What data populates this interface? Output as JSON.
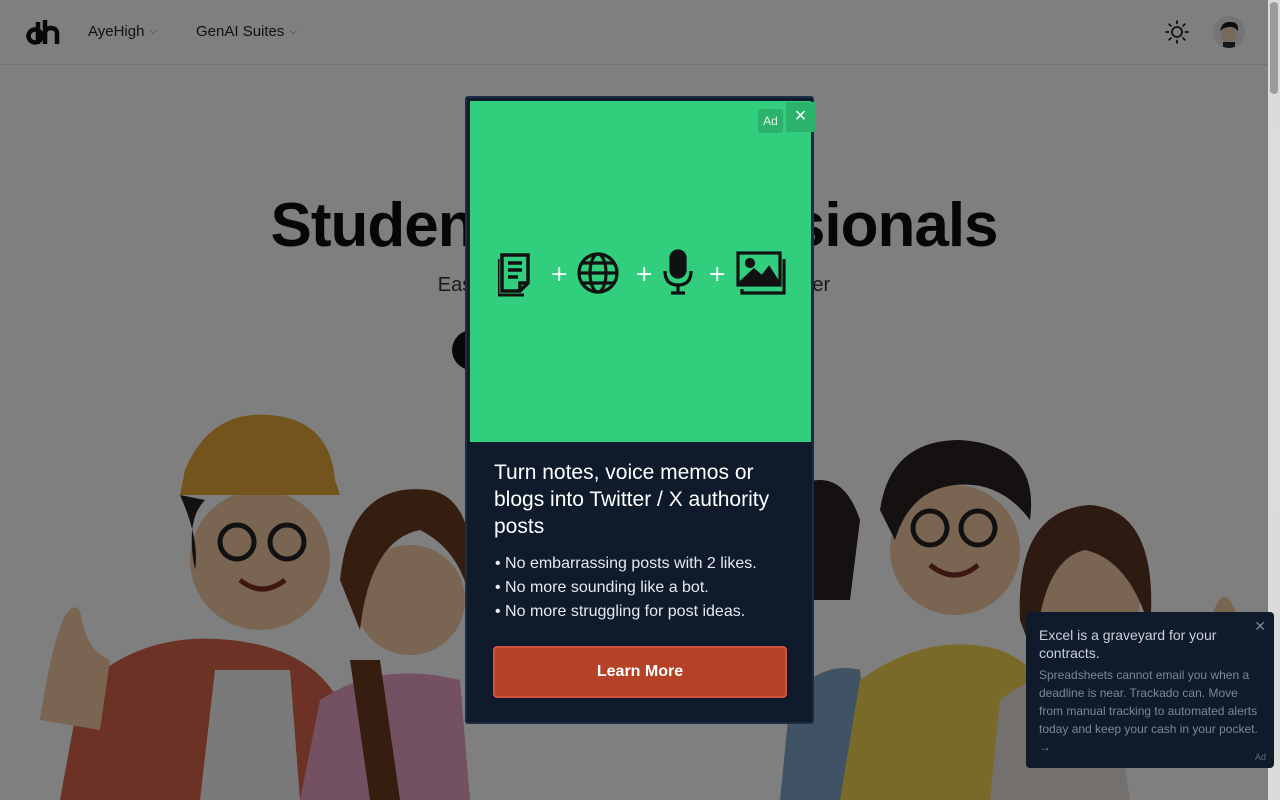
{
  "header": {
    "logo_text": "dh",
    "nav": [
      {
        "label": "AyeHigh"
      },
      {
        "label": "GenAI Suites"
      }
    ],
    "icons": {
      "chevron": "chevron-down-icon",
      "theme": "sun-icon",
      "avatar": "user-avatar"
    }
  },
  "hero": {
    "title": "Students & Professionals",
    "subtitle": "Easy to use AI tools for Academics & Career"
  },
  "ad_modal": {
    "badge": "Ad",
    "close_label": "×",
    "icons": [
      "document-icon",
      "globe-icon",
      "microphone-icon",
      "image-icon"
    ],
    "plus": "+",
    "headline": "Turn notes, voice memos or blogs into Twitter / X authority posts",
    "bullets": [
      "• No embarrassing posts with 2 likes.",
      "• No more sounding like a bot.",
      "• No more struggling for post ideas."
    ],
    "cta_label": "Learn More",
    "colors": {
      "image_bg": "#31cf7d",
      "panel_bg": "#0f1a2b",
      "cta_bg": "#b54226"
    }
  },
  "side_ad": {
    "title": "Excel is a graveyard for your contracts.",
    "body": "Spreadsheets cannot email you when a deadline is near. Trackado can. Move from manual tracking to automated alerts today and keep your cash in your pocket. →",
    "close_label": "✕",
    "tag": "Ad"
  }
}
